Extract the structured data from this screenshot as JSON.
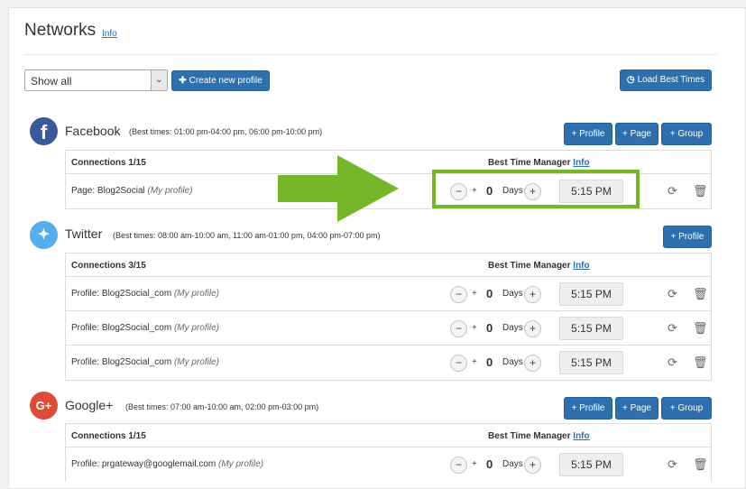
{
  "header": {
    "title": "Networks",
    "info_link": "Info"
  },
  "toolbar": {
    "filter_value": "Show all",
    "create_profile": "Create new profile",
    "load_best_times": "Load Best Times"
  },
  "icons": {
    "plus": "+",
    "clock": "clock-icon",
    "chevron": "chevron-down-icon",
    "refresh": "refresh-icon",
    "trash": "trash-icon"
  },
  "colors": {
    "primary": "#2d70ad",
    "facebook": "#3b5998",
    "twitter": "#55acee",
    "google": "#dd4b39",
    "highlight": "#76b72a"
  },
  "networks": [
    {
      "name": "Facebook",
      "best_times": "(Best times: 01:00 pm-04:00 pm, 06:00 pm-10:00 pm)",
      "buttons": [
        "+ Profile",
        "+ Page",
        "+ Group"
      ],
      "connections": "Connections 1/15",
      "best_time_manager": "Best Time Manager",
      "btm_info": "Info",
      "rows": [
        {
          "type": "Page:",
          "name": "Blog2Social",
          "note": "(My profile)",
          "days": "0",
          "days_label": "Days",
          "time": "5:15 PM"
        }
      ]
    },
    {
      "name": "Twitter",
      "best_times": "(Best times: 08:00 am-10:00 am, 11:00 am-01:00 pm, 04:00 pm-07:00 pm)",
      "buttons": [
        "+ Profile"
      ],
      "connections": "Connections 3/15",
      "best_time_manager": "Best Time Manager",
      "btm_info": "Info",
      "rows": [
        {
          "type": "Profile:",
          "name": "Blog2Social_com",
          "note": "(My profile)",
          "days": "0",
          "days_label": "Days",
          "time": "5:15 PM"
        },
        {
          "type": "Profile:",
          "name": "Blog2Social_com",
          "note": "(My profile)",
          "days": "0",
          "days_label": "Days",
          "time": "5:15 PM"
        },
        {
          "type": "Profile:",
          "name": "Blog2Social_com",
          "note": "(My profile)",
          "days": "0",
          "days_label": "Days",
          "time": "5:15 PM"
        }
      ]
    },
    {
      "name": "Google+",
      "best_times": "(Best times: 07:00 am-10:00 am, 02:00 pm-03:00 pm)",
      "buttons": [
        "+ Profile",
        "+ Page",
        "+ Group"
      ],
      "connections": "Connections 1/15",
      "best_time_manager": "Best Time Manager",
      "btm_info": "Info",
      "rows": [
        {
          "type": "Profile:",
          "name": "prgateway@googlemail.com",
          "note": "(My profile)",
          "days": "0",
          "days_label": "Days",
          "time": "5:15 PM"
        }
      ]
    }
  ]
}
